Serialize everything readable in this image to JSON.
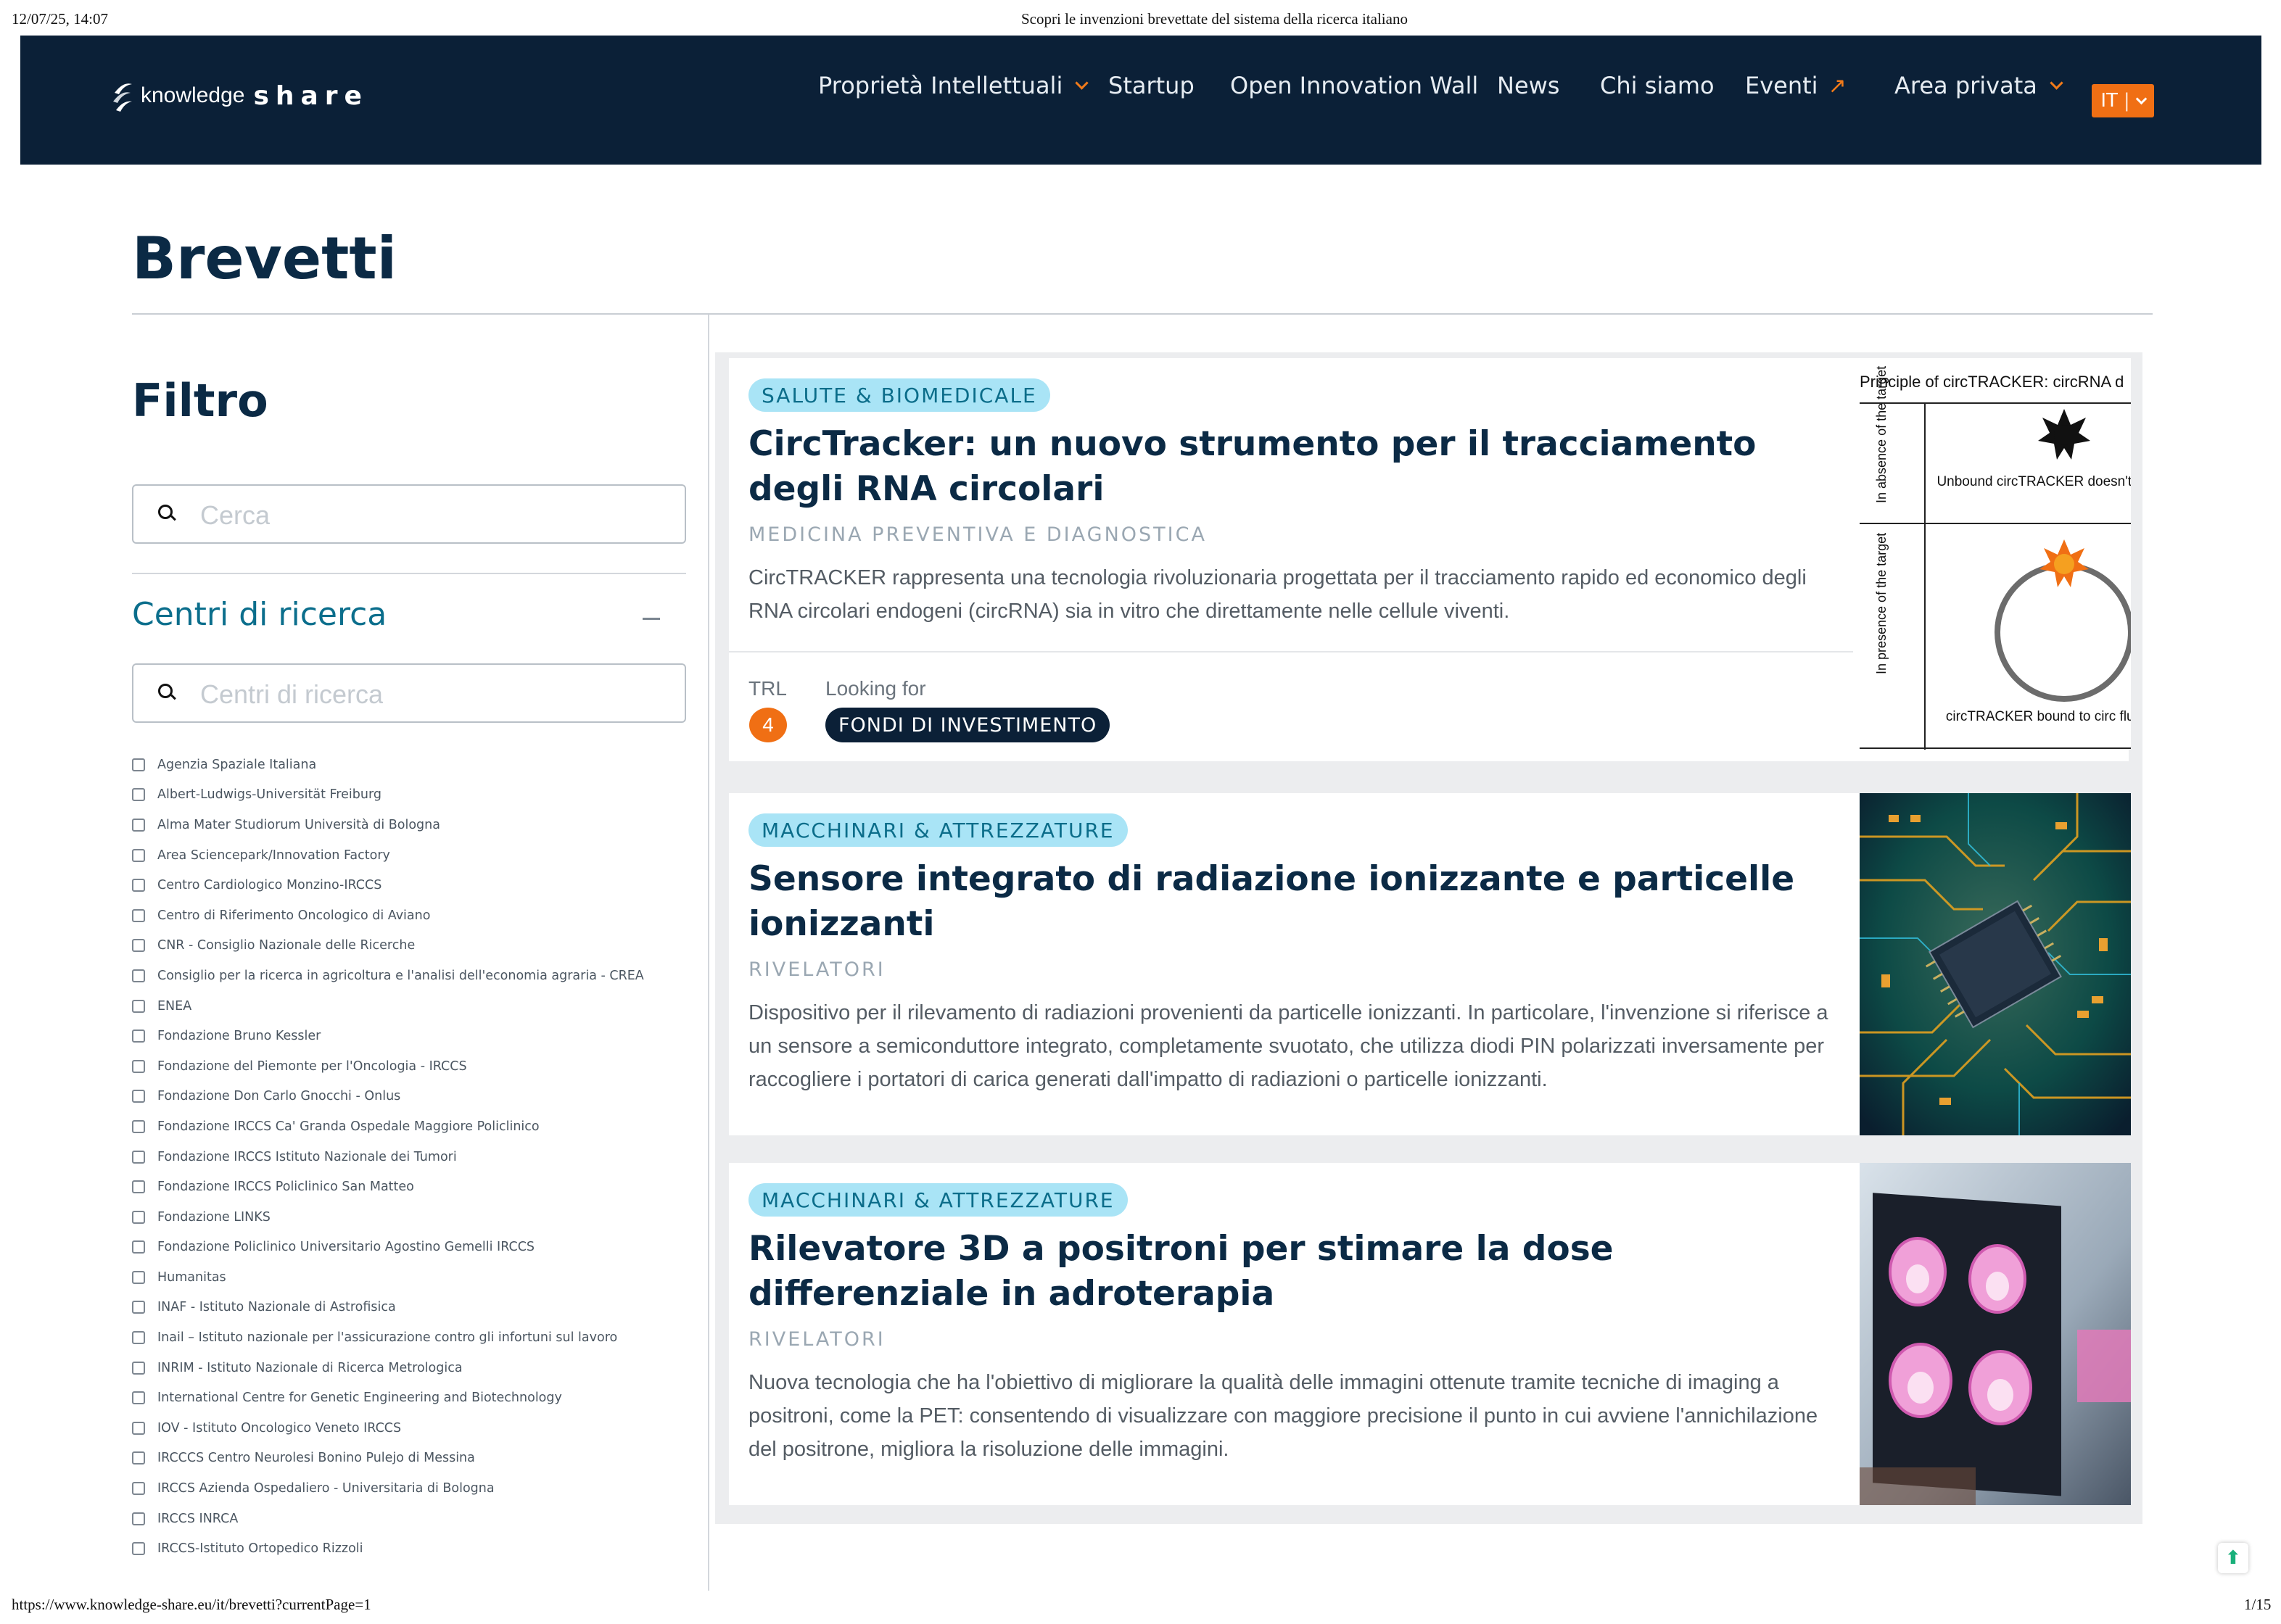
{
  "print_header": {
    "datetime": "12/07/25, 14:07",
    "doc_title": "Scopri le invenzioni brevettate del sistema della ricerca italiano"
  },
  "print_footer": {
    "url": "https://www.knowledge-share.eu/it/brevetti?currentPage=1",
    "page": "1/15"
  },
  "nav": {
    "logo_left": "knowledge",
    "logo_right": "share",
    "items": [
      {
        "label": "Proprietà Intellettuali",
        "icon": "chevron-down-icon"
      },
      {
        "label": "Startup"
      },
      {
        "label": "Open Innovation Wall"
      },
      {
        "label": "News"
      },
      {
        "label": "Chi siamo"
      },
      {
        "label": "Eventi",
        "icon": "external-arrow-icon"
      },
      {
        "label": "Area privata",
        "icon": "chevron-down-icon"
      }
    ],
    "language": "IT",
    "accent_color": "#f06f14",
    "background_color": "#0b2037"
  },
  "page": {
    "title": "Brevetti"
  },
  "filter": {
    "title": "Filtro",
    "search_placeholder": "Cerca",
    "centri": {
      "title": "Centri di ricerca",
      "search_placeholder": "Centri di ricerca",
      "options": [
        "Agenzia Spaziale Italiana",
        "Albert-Ludwigs-Universität Freiburg",
        "Alma Mater Studiorum Università di Bologna",
        "Area Sciencepark/Innovation Factory",
        "Centro Cardiologico Monzino-IRCCS",
        "Centro di Riferimento Oncologico di Aviano",
        "CNR - Consiglio Nazionale delle Ricerche",
        "Consiglio per la ricerca in agricoltura e l'analisi dell'economia agraria - CREA",
        "ENEA",
        "Fondazione Bruno Kessler",
        "Fondazione del Piemonte per l'Oncologia - IRCCS",
        "Fondazione Don Carlo Gnocchi - Onlus",
        "Fondazione IRCCS Ca' Granda Ospedale Maggiore Policlinico",
        "Fondazione IRCCS Istituto Nazionale dei Tumori",
        "Fondazione IRCCS Policlinico San Matteo",
        "Fondazione LINKS",
        "Fondazione Policlinico Universitario Agostino Gemelli IRCCS",
        "Humanitas",
        "INAF - Istituto Nazionale di Astrofisica",
        "Inail – Istituto nazionale per l'assicurazione contro gli infortuni sul lavoro",
        "INRIM - Istituto Nazionale di Ricerca Metrologica",
        "International Centre for Genetic Engineering and Biotechnology",
        "IOV - Istituto Oncologico Veneto IRCCS",
        "IRCCCS Centro Neurolesi Bonino Pulejo di Messina",
        "IRCCS Azienda Ospedaliero - Universitaria di Bologna",
        "IRCCS INRCA",
        "IRCCS-Istituto Ortopedico Rizzoli"
      ]
    }
  },
  "cards": [
    {
      "category": "SALUTE & BIOMEDICALE",
      "title": "CircTracker: un nuovo strumento per il tracciamento degli RNA circolari",
      "subcategory": "MEDICINA PREVENTIVA E DIAGNOSTICA",
      "description": "CircTRACKER rappresenta una tecnologia rivoluzionaria progettata per il tracciamento rapido ed economico degli RNA circolari endogeni (circRNA) sia in vitro che direttamente nelle cellule viventi.",
      "trl_label": "TRL",
      "trl_value": "4",
      "looking_for_label": "Looking for",
      "looking_for_value": "FONDI DI INVESTIMENTO",
      "image": {
        "heading": "Principle of circTRACKER: circRNA d",
        "row1_label": "In absence of the target",
        "row1_caption": "Unbound circTRACKER doesn't fluoresce",
        "row2_label": "In presence of the target",
        "row2_caption": "circTRACKER bound to circ fluoresces"
      }
    },
    {
      "category": "MACCHINARI & ATTREZZATURE",
      "title": "Sensore integrato di radiazione ionizzante e particelle ionizzanti",
      "subcategory": "RIVELATORI",
      "description": "Dispositivo per il rilevamento di radiazioni provenienti da particelle ionizzanti. In particolare, l'invenzione si riferisce a un sensore a semiconduttore integrato, completamente svuotato, che utilizza diodi PIN polarizzati inversamente per raccogliere i portatori di carica generati dall'impatto di radiazioni o particelle ionizzanti."
    },
    {
      "category": "MACCHINARI & ATTREZZATURE",
      "title": "Rilevatore 3D a positroni per stimare la dose differenziale in adroterapia",
      "subcategory": "RIVELATORI",
      "description": "Nuova tecnologia che ha l'obiettivo di migliorare la qualità delle immagini ottenute tramite tecniche di imaging a positroni, come la PET: consentendo di visualizzare con maggiore precisione il punto in cui avviene l'annichilazione del positrone, migliora la risoluzione delle immagini."
    }
  ]
}
